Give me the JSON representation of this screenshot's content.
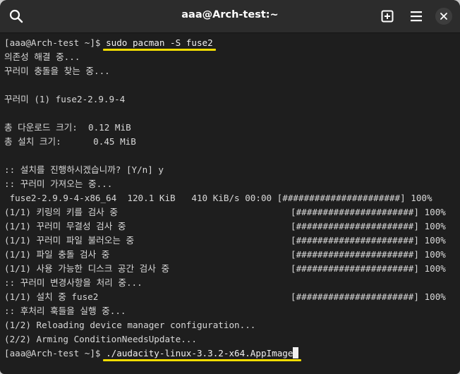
{
  "window": {
    "title": "aaa@Arch-test:~"
  },
  "terminal": {
    "lines": [
      "[aaa@Arch-test ~]$ sudo pacman -S fuse2",
      "의존성 해결 중...",
      "꾸러미 충돌을 찾는 중...",
      "",
      "꾸러미 (1) fuse2-2.9.9-4",
      "",
      "총 다운로드 크기:  0.12 MiB",
      "총 설치 크기:      0.45 MiB",
      "",
      ":: 설치를 진행하시겠습니까? [Y/n] y",
      ":: 꾸러미 가져오는 중...",
      " fuse2-2.9.9-4-x86_64  120.1 KiB   410 KiB/s 00:00 [######################] 100%",
      "(1/1) 키링의 키를 검사 중",
      "(1/1) 꾸러미 무결성 검사 중",
      "(1/1) 꾸러미 파일 불러오는 중",
      "(1/1) 파일 충돌 검사 중",
      "(1/1) 사용 가능한 디스크 공간 검사 중",
      ":: 꾸러미 변경사항을 처리 중...",
      "(1/1) 설치 중 fuse2",
      ":: 후처리 훅들을 실행 중...",
      "(1/2) Reloading device manager configuration...",
      "(2/2) Arming ConditionNeedsUpdate...",
      "[aaa@Arch-test ~]$ ./audacity-linux-3.3.2-x64.AppImage"
    ],
    "progress": [
      {
        "row": 12,
        "text": "[######################] 100%"
      },
      {
        "row": 13,
        "text": "[######################] 100%"
      },
      {
        "row": 14,
        "text": "[######################] 100%"
      },
      {
        "row": 15,
        "text": "[######################] 100%"
      },
      {
        "row": 16,
        "text": "[######################] 100%"
      },
      {
        "row": 18,
        "text": "[######################] 100%"
      }
    ],
    "highlight_color": "#f3dd00"
  },
  "icons": {
    "search": "search-icon",
    "new_tab": "new-tab-icon",
    "menu": "hamburger-menu-icon",
    "close": "close-icon"
  }
}
